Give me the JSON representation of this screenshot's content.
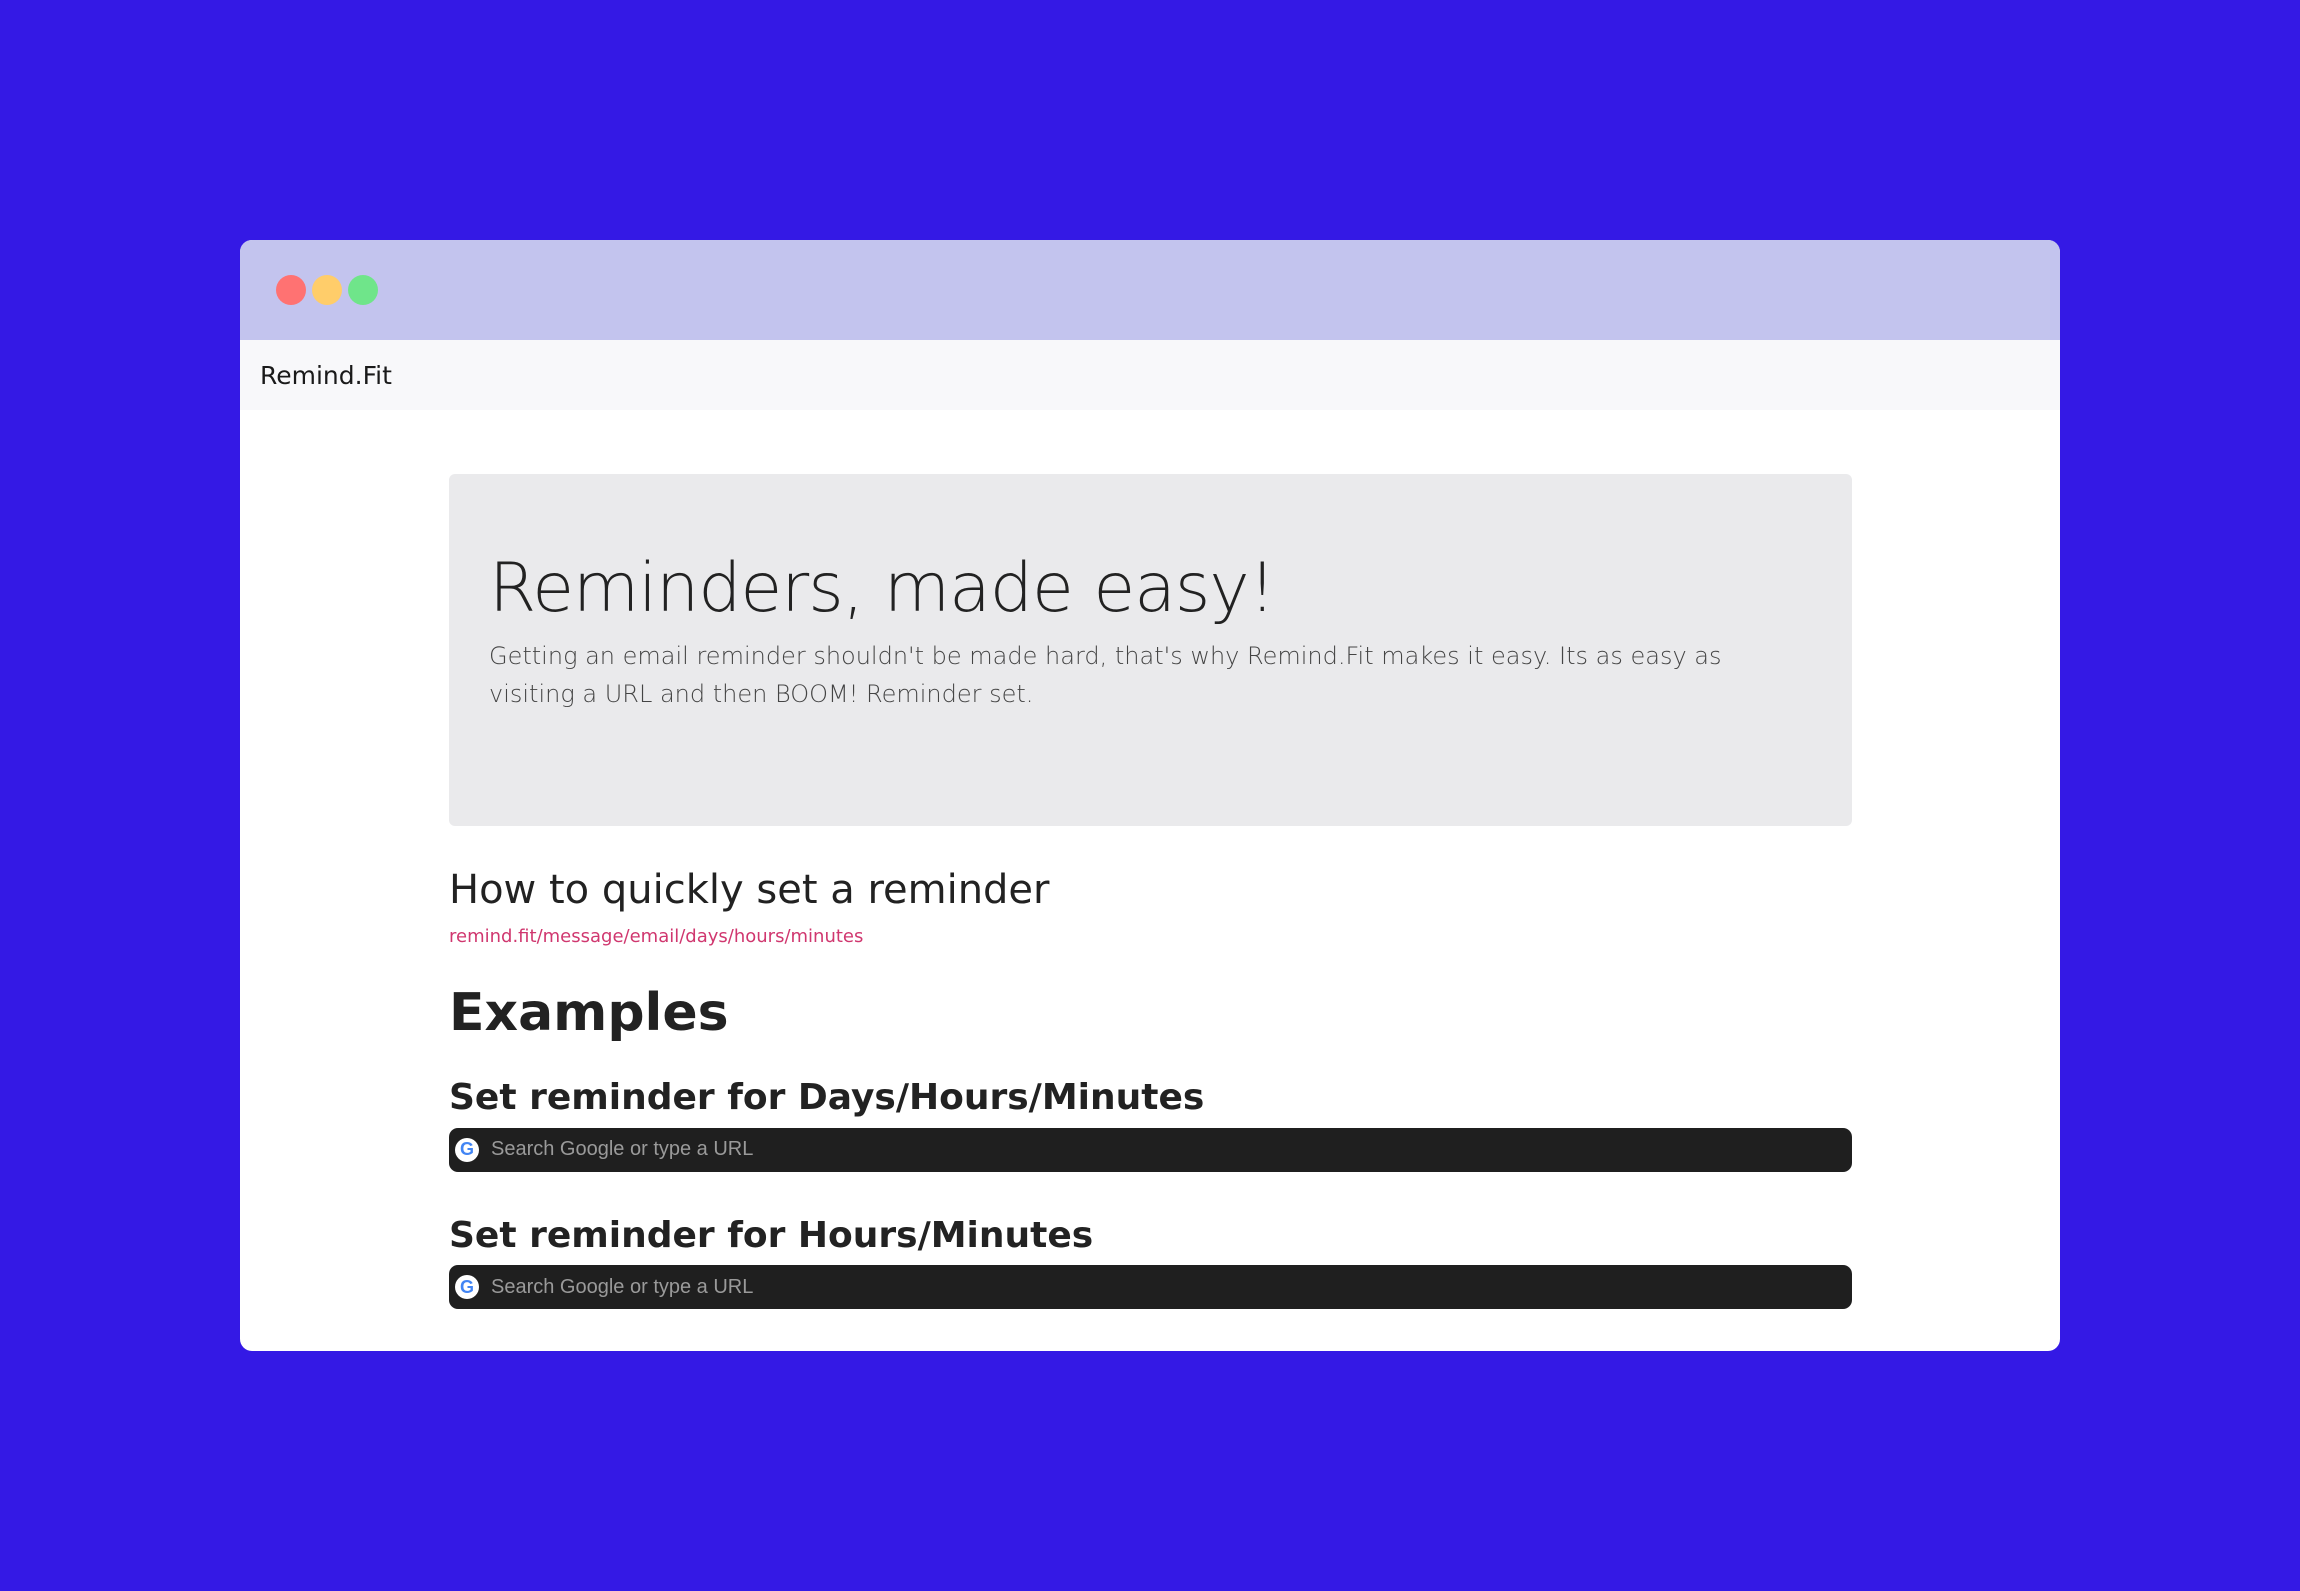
{
  "window": {
    "controls": [
      "close",
      "minimize",
      "maximize"
    ]
  },
  "navbar": {
    "brand": "Remind.Fit"
  },
  "hero": {
    "title": "Reminders, made easy!",
    "description": "Getting an email reminder shouldn't be made hard, that's why Remind.Fit makes it easy. Its as easy as visiting a URL and then BOOM! Reminder set."
  },
  "howto": {
    "title": "How to quickly set a reminder",
    "url_pattern": "remind.fit/message/email/days/hours/minutes"
  },
  "examples": {
    "title": "Examples",
    "items": [
      {
        "title": "Set reminder for Days/Hours/Minutes",
        "placeholder": "Search Google or type a URL"
      },
      {
        "title": "Set reminder for Hours/Minutes",
        "placeholder": "Search Google or type a URL"
      }
    ]
  },
  "colors": {
    "background": "#3419e5",
    "titlebar": "#c3c4ee",
    "jumbotron": "#eaeaec",
    "code": "#d0376f",
    "addressbar": "#1f1f1f"
  }
}
